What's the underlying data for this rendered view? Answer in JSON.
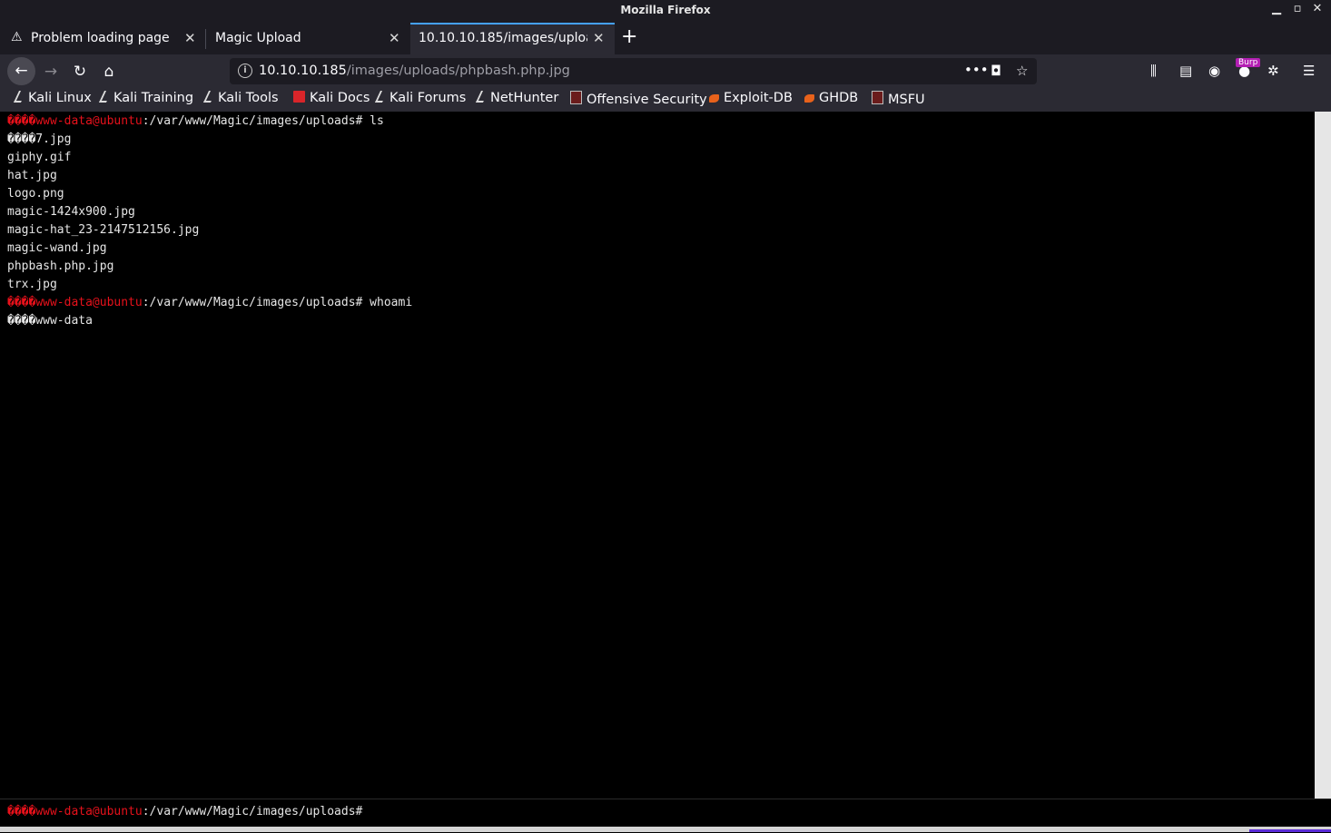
{
  "window": {
    "title": "Mozilla Firefox",
    "controls": [
      "minimize-icon",
      "maximize-icon",
      "close-icon"
    ]
  },
  "tabs": [
    {
      "label": "Problem loading page",
      "icon": "warning-icon",
      "active": false
    },
    {
      "label": "Magic Upload",
      "icon": "",
      "active": false
    },
    {
      "label": "10.10.10.185/images/uploads/phpbash.php.jpg",
      "icon": "",
      "active": true
    }
  ],
  "navbar": {
    "url_host": "10.10.10.185",
    "url_path": "/images/uploads/phpbash.php.jpg",
    "burp_badge": "Burp"
  },
  "bookmarks": [
    {
      "label": "Kali Linux",
      "icon": "kali-dragon-icon"
    },
    {
      "label": "Kali Training",
      "icon": "kali-dragon-icon"
    },
    {
      "label": "Kali Tools",
      "icon": "kali-dragon-icon"
    },
    {
      "label": "Kali Docs",
      "icon": "pdf-icon"
    },
    {
      "label": "Kali Forums",
      "icon": "kali-dragon-icon"
    },
    {
      "label": "NetHunter",
      "icon": "kali-dragon-icon"
    },
    {
      "label": "Offensive Security",
      "icon": "offsec-icon"
    },
    {
      "label": "Exploit-DB",
      "icon": "exploit-db-icon"
    },
    {
      "label": "GHDB",
      "icon": "exploit-db-icon"
    },
    {
      "label": "MSFU",
      "icon": "offsec-icon"
    }
  ],
  "terminal": {
    "prompt_glyphs": "����",
    "prompt_user": "www-data@ubuntu",
    "prompt_path": ":/var/www/Magic/images/uploads#",
    "lines": [
      {
        "type": "prompt",
        "cmd": " ls"
      },
      {
        "type": "out",
        "text": "����7.jpg"
      },
      {
        "type": "out",
        "text": "giphy.gif"
      },
      {
        "type": "out",
        "text": "hat.jpg"
      },
      {
        "type": "out",
        "text": "logo.png"
      },
      {
        "type": "out",
        "text": "magic-1424x900.jpg"
      },
      {
        "type": "out",
        "text": "magic-hat_23-2147512156.jpg"
      },
      {
        "type": "out",
        "text": "magic-wand.jpg"
      },
      {
        "type": "out",
        "text": "phpbash.php.jpg"
      },
      {
        "type": "out",
        "text": "trx.jpg"
      },
      {
        "type": "prompt",
        "cmd": " whoami"
      },
      {
        "type": "out",
        "text": "����www-data"
      }
    ],
    "input_prompt_path": ":/var/www/Magic/images/uploads#"
  },
  "colors": {
    "prompt_red": "#e8111b",
    "chrome_dark": "#1c1b22",
    "toolbar": "#2b2a33",
    "active_tab_accent": "#45a1ff"
  }
}
